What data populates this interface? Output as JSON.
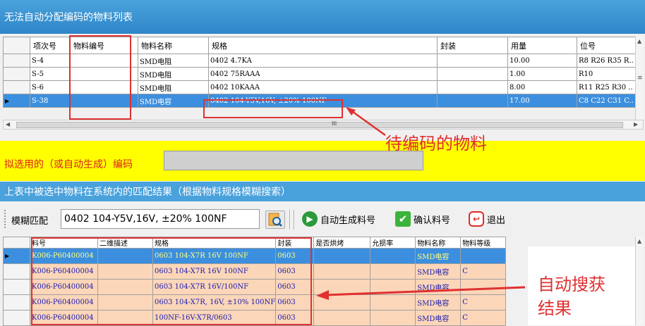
{
  "window": {
    "title": "无法自动分配编码的物料列表"
  },
  "top_table": {
    "columns": [
      "项次号",
      "物料编号",
      "物料名称",
      "规格",
      "封装",
      "用量",
      "位号"
    ],
    "rows": [
      [
        "S-4",
        "",
        "SMD电阻",
        "0402 4.7KA",
        "",
        "10.00",
        "R8 R26 R35 R.."
      ],
      [
        "S-5",
        "",
        "SMD电阻",
        "0402 75RAAA",
        "",
        "1.00",
        "R10"
      ],
      [
        "S-6",
        "",
        "SMD电阻",
        "0402 10KAAA",
        "",
        "8.00",
        "R11 R25 R30 .."
      ],
      [
        "S-38",
        "",
        "SMD电容",
        "0402 104-Y5V,16V, ±20% 100NF",
        "",
        "17.00",
        "C8 C22 C31 C.."
      ]
    ],
    "selected_row": 3,
    "hscroll_grip": "III"
  },
  "code_section": {
    "label": "拟选用的（或自动生成）编码",
    "value": ""
  },
  "result_header": "上表中被选中物料在系统内的匹配结果（根据物料规格模糊搜索）",
  "toolbar": {
    "fuzzy_label": "模糊匹配",
    "fuzzy_value": "0402 104-Y5V,16V, ±20% 100NF",
    "auto_gen_label": "自动生成料号",
    "confirm_label": "确认料号",
    "exit_label": "退出"
  },
  "bottom_table": {
    "columns": [
      "料号",
      "二维描述",
      "规格",
      "封装",
      "是否烘烤",
      "允损率",
      "物料名称",
      "物料等级"
    ],
    "rows": [
      [
        "K006-P60400004",
        "",
        "0603 104-X7R 16V 100NF",
        "0603",
        "",
        "",
        "SMD电容",
        ""
      ],
      [
        "K006-P60400004",
        "",
        "0603 104-X7R 16V 100NF",
        "0603",
        "",
        "",
        "SMD电容",
        "C"
      ],
      [
        "K006-P60400004",
        "",
        "0603 104-X7R 16V/100NF",
        "0603",
        "",
        "",
        "SMD电容",
        ""
      ],
      [
        "K006-P60400004",
        "",
        "0603 104-X7R, 16V, ±10% 100NF",
        "0603",
        "",
        "",
        "SMD电容",
        "C"
      ],
      [
        "K006-P60400004",
        "",
        "100NF-16V-X7R/0603",
        "0603",
        "",
        "",
        "SMD电容",
        "C"
      ]
    ],
    "selected_row": 0
  },
  "annotations": {
    "pending": "待编码的物料",
    "auto_result_line1": "自动搜获",
    "auto_result_line2": "结果"
  },
  "colors": {
    "title_bar": "#3a93d4",
    "selection": "#3c8fde",
    "highlight_row": "#fbd6b8",
    "annotation": "#e03030",
    "yellow_bar": "#ffff00"
  },
  "icons": [
    "row-pointer-icon",
    "search-icon",
    "play-icon",
    "check-icon",
    "exit-icon",
    "scroll-up-icon",
    "scroll-down-icon",
    "scroll-left-icon",
    "scroll-right-icon"
  ]
}
